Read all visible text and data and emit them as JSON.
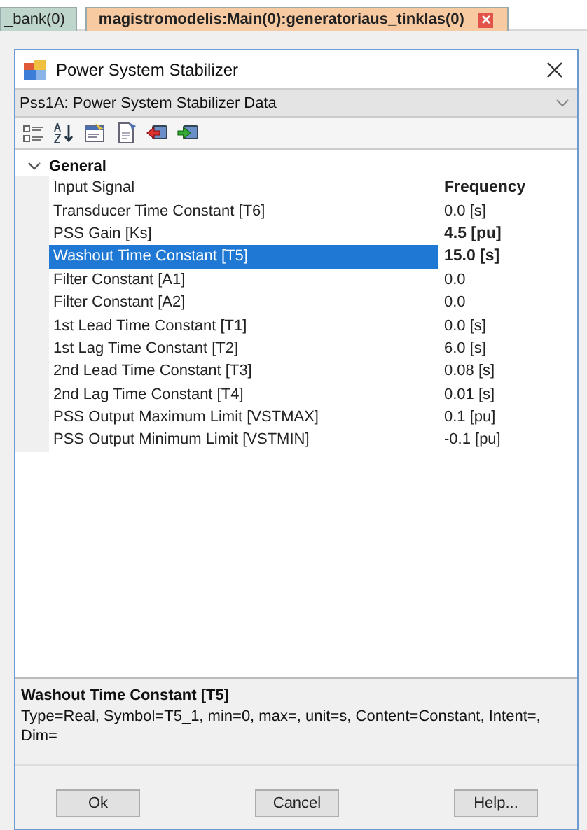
{
  "document_tabs": [
    {
      "label": "_bank(0)",
      "selected": false,
      "closable": false
    },
    {
      "label": "magistromodelis:Main(0):generatoriaus_tinklas(0)",
      "selected": true,
      "closable": true
    }
  ],
  "window": {
    "title": "Power System Stabilizer"
  },
  "object_selector": {
    "value": "Pss1A: Power System Stabilizer Data"
  },
  "toolbar": [
    {
      "kind": "categorized"
    },
    {
      "kind": "alphabetical"
    },
    {
      "kind": "properties"
    },
    {
      "kind": "page"
    },
    {
      "kind": "export"
    },
    {
      "kind": "import"
    }
  ],
  "property_grid": {
    "category": {
      "label": "General",
      "expanded": true
    },
    "rows": [
      {
        "name": "Input Signal",
        "value": "Frequency",
        "modified": true,
        "selected": false
      },
      {
        "name": "Transducer Time Constant [T6]",
        "value": "0.0 [s]",
        "modified": false,
        "selected": false
      },
      {
        "name": "PSS Gain [Ks]",
        "value": "4.5 [pu]",
        "modified": true,
        "selected": false
      },
      {
        "name": "Washout Time Constant [T5]",
        "value": "15.0 [s]",
        "modified": true,
        "selected": true
      },
      {
        "name": "Filter Constant [A1]",
        "value": "0.0",
        "modified": false,
        "selected": false
      },
      {
        "name": "Filter Constant [A2]",
        "value": "0.0",
        "modified": false,
        "selected": false
      },
      {
        "name": "1st Lead Time Constant [T1]",
        "value": "0.0 [s]",
        "modified": false,
        "selected": false
      },
      {
        "name": "1st Lag Time Constant [T2]",
        "value": "6.0 [s]",
        "modified": false,
        "selected": false
      },
      {
        "name": "2nd Lead Time Constant [T3]",
        "value": "0.08 [s]",
        "modified": false,
        "selected": false
      },
      {
        "name": "2nd Lag Time Constant [T4]",
        "value": "0.01 [s]",
        "modified": false,
        "selected": false
      },
      {
        "name": "PSS Output Maximum Limit [VSTMAX]",
        "value": "0.1 [pu]",
        "modified": false,
        "selected": false
      },
      {
        "name": "PSS Output Minimum Limit [VSTMIN]",
        "value": "-0.1 [pu]",
        "modified": false,
        "selected": false
      }
    ]
  },
  "description": {
    "title": "Washout Time Constant [T5]",
    "text": "Type=Real, Symbol=T5_1, min=0, max=, unit=s, Content=Constant, Intent=, Dim="
  },
  "buttons": [
    "Ok",
    "Cancel",
    "Help..."
  ]
}
